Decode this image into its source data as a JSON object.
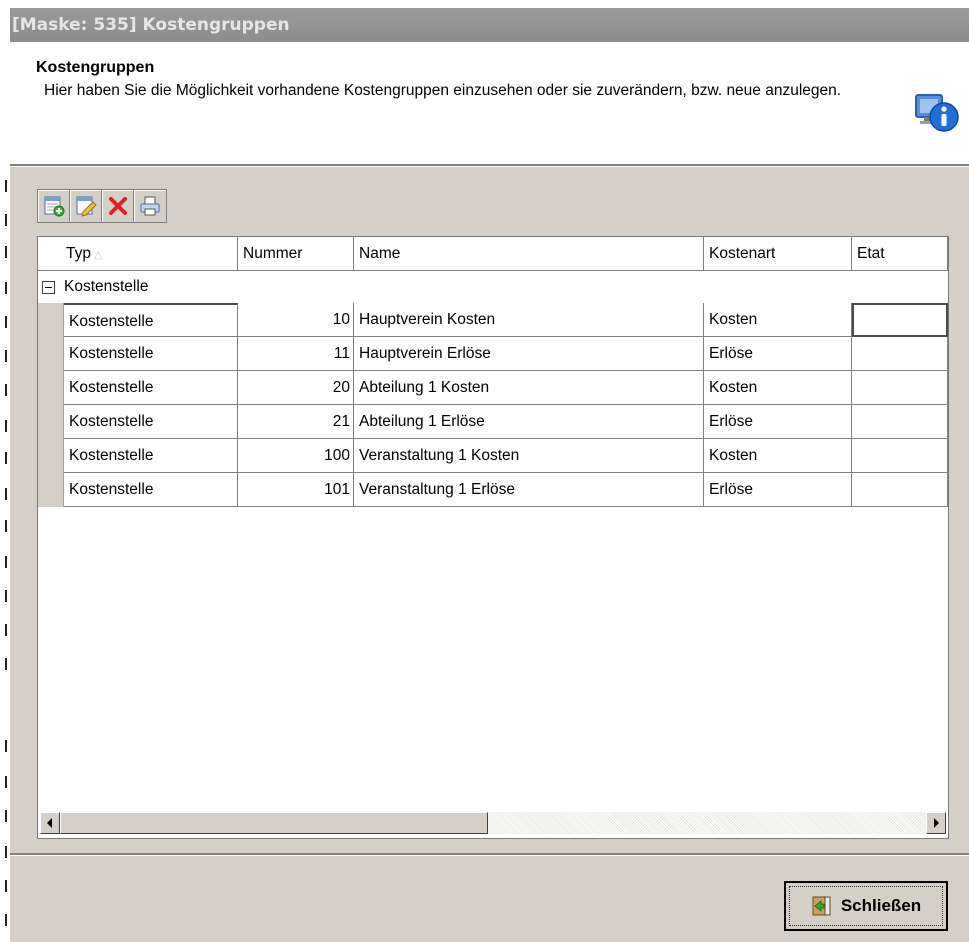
{
  "window": {
    "title": "[Maske: 535] Kostengruppen"
  },
  "header": {
    "title": "Kostengruppen",
    "description": "Hier haben Sie die Möglichkeit vorhandene Kostengruppen einzusehen oder sie zuverändern, bzw. neue anzulegen.",
    "icon": "info-icon"
  },
  "toolbar": {
    "buttons": [
      {
        "name": "add-icon"
      },
      {
        "name": "edit-icon"
      },
      {
        "name": "delete-icon"
      },
      {
        "name": "print-icon"
      }
    ]
  },
  "grid": {
    "columns": [
      "Typ",
      "Nummer",
      "Name",
      "Kostenart",
      "Etat"
    ],
    "sort": {
      "column": "Typ",
      "direction": "ascending"
    },
    "group": {
      "label": "Kostenstelle",
      "expanded": true
    },
    "rows": [
      {
        "typ": "Kostenstelle",
        "nummer": "10",
        "name": "Hauptverein Kosten",
        "kostenart": "Kosten",
        "etat": ""
      },
      {
        "typ": "Kostenstelle",
        "nummer": "11",
        "name": "Hauptverein Erlöse",
        "kostenart": "Erlöse",
        "etat": ""
      },
      {
        "typ": "Kostenstelle",
        "nummer": "20",
        "name": "Abteilung 1 Kosten",
        "kostenart": "Kosten",
        "etat": ""
      },
      {
        "typ": "Kostenstelle",
        "nummer": "21",
        "name": "Abteilung 1 Erlöse",
        "kostenart": "Erlöse",
        "etat": ""
      },
      {
        "typ": "Kostenstelle",
        "nummer": "100",
        "name": "Veranstaltung 1 Kosten",
        "kostenart": "Kosten",
        "etat": ""
      },
      {
        "typ": "Kostenstelle",
        "nummer": "101",
        "name": "Veranstaltung 1 Erlöse",
        "kostenart": "Erlöse",
        "etat": ""
      }
    ]
  },
  "footer": {
    "close_label": "Schließen"
  }
}
